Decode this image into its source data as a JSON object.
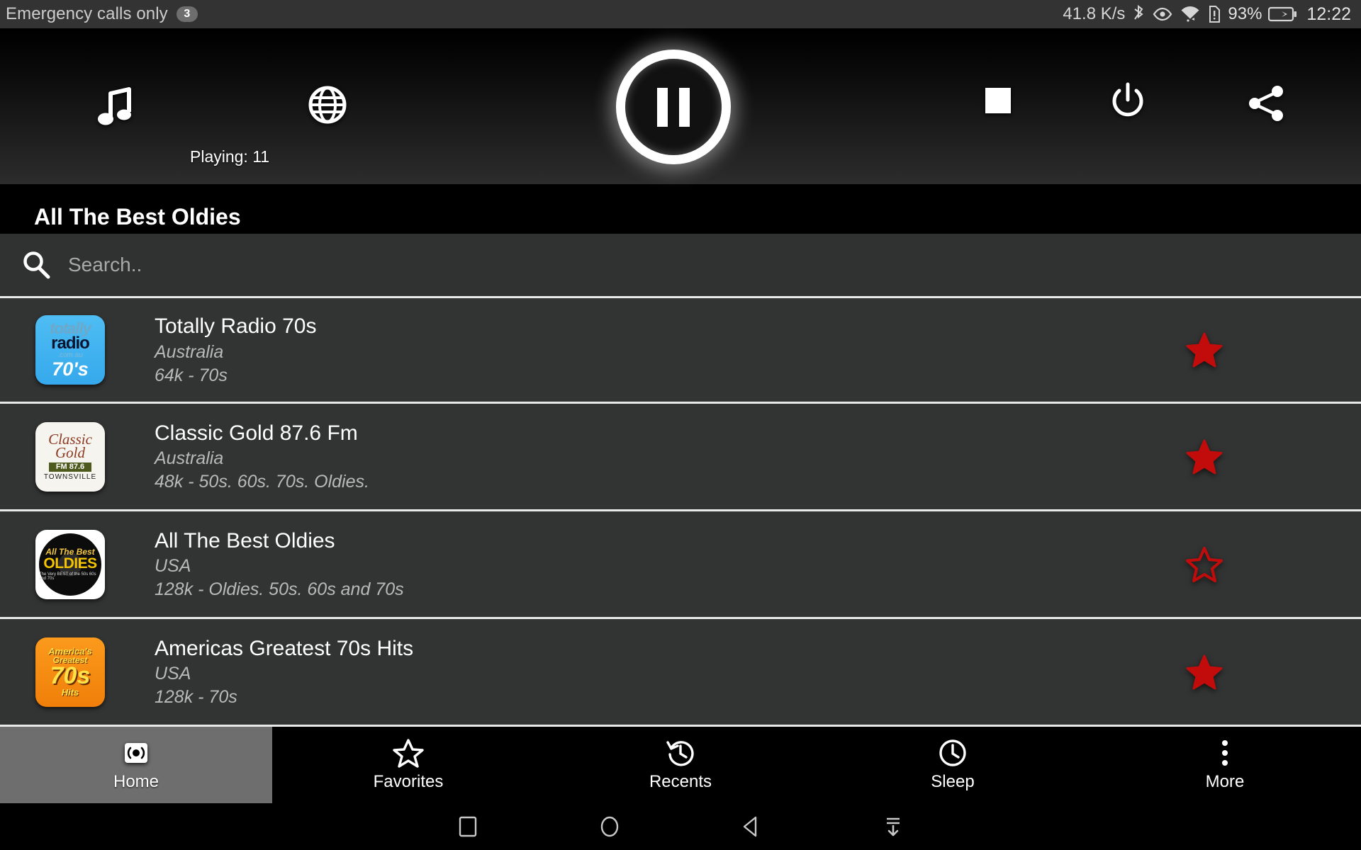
{
  "statusbar": {
    "carrier": "Emergency calls only",
    "notification_count": "3",
    "network_speed": "41.8 K/s",
    "battery_percent": "93%",
    "time": "12:22",
    "icons": [
      "bluetooth-icon",
      "eye-icon",
      "wifi-icon",
      "sim-alert-icon",
      "battery-charging-icon"
    ]
  },
  "player": {
    "music_icon": "music-note-icon",
    "globe_icon": "globe-icon",
    "playing_label": "Playing: 11",
    "play_state": "pause",
    "stop_icon": "stop-icon",
    "power_icon": "power-icon",
    "share_icon": "share-icon",
    "now_playing_title": "All The Best Oldies"
  },
  "search": {
    "placeholder": "Search..",
    "value": "",
    "icon": "search-icon"
  },
  "stations": [
    {
      "name": "Totally Radio 70s",
      "country": "Australia",
      "info": "64k - 70s",
      "favorite": true,
      "logo": {
        "style": "tw1",
        "line1": "totally",
        "line2": "radio",
        "line3": ".com.au",
        "line4": "70's"
      }
    },
    {
      "name": "Classic Gold 87.6 Fm",
      "country": "Australia",
      "info": "48k - 50s. 60s. 70s. Oldies.",
      "favorite": true,
      "logo": {
        "style": "tw2",
        "line1": "Classic",
        "line2": "Gold",
        "line3": "FM 87.6",
        "line4": "TOWNSVILLE"
      }
    },
    {
      "name": "All The Best Oldies",
      "country": "USA",
      "info": "128k - Oldies. 50s. 60s and 70s",
      "favorite": false,
      "logo": {
        "style": "tw3",
        "line1": "All The Best",
        "line2": "OLDIES",
        "line3": "The Very BEST of the 50s 60s and 70s",
        "line4": ""
      }
    },
    {
      "name": "Americas Greatest 70s Hits",
      "country": "USA",
      "info": "128k - 70s",
      "favorite": true,
      "logo": {
        "style": "tw4",
        "line1": "America's",
        "line2": "Greatest",
        "line3": "70s",
        "line4": "Hits"
      }
    }
  ],
  "bottom_nav": {
    "active_index": 0,
    "items": [
      {
        "label": "Home",
        "icon": "radio-broadcast-icon"
      },
      {
        "label": "Favorites",
        "icon": "star-outline-icon"
      },
      {
        "label": "Recents",
        "icon": "history-icon"
      },
      {
        "label": "Sleep",
        "icon": "clock-icon"
      },
      {
        "label": "More",
        "icon": "overflow-menu-icon"
      }
    ]
  },
  "android_nav": {
    "items": [
      {
        "icon": "recents-square-icon"
      },
      {
        "icon": "home-circle-icon"
      },
      {
        "icon": "back-triangle-icon"
      },
      {
        "icon": "hide-keyboard-icon"
      }
    ]
  },
  "colors": {
    "favorite_star": "#c20c0c",
    "statusbar_bg": "#333333",
    "row_bg": "#323333",
    "nav_active_bg": "#6e6e6e"
  }
}
